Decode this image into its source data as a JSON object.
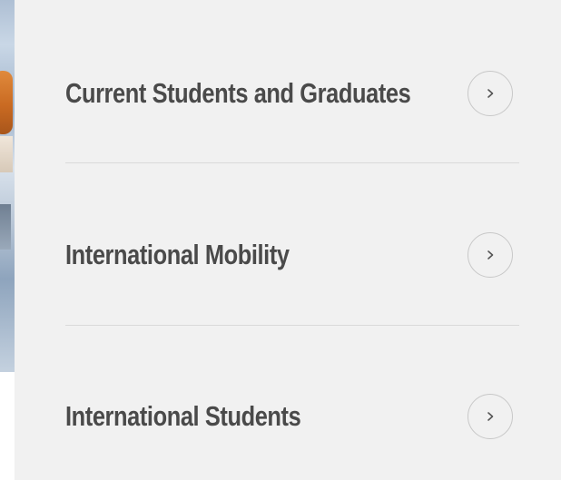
{
  "menu": {
    "items": [
      {
        "label": "Current Students and Graduates",
        "icon": "chevron-right-icon"
      },
      {
        "label": "International Mobility",
        "icon": "chevron-right-icon"
      },
      {
        "label": "International Students",
        "icon": "chevron-right-icon"
      }
    ]
  },
  "colors": {
    "panel_background": "#f1f1f1",
    "text": "#4a4a4a",
    "divider": "#d9d9d9",
    "button_border": "#c8c8c8"
  }
}
